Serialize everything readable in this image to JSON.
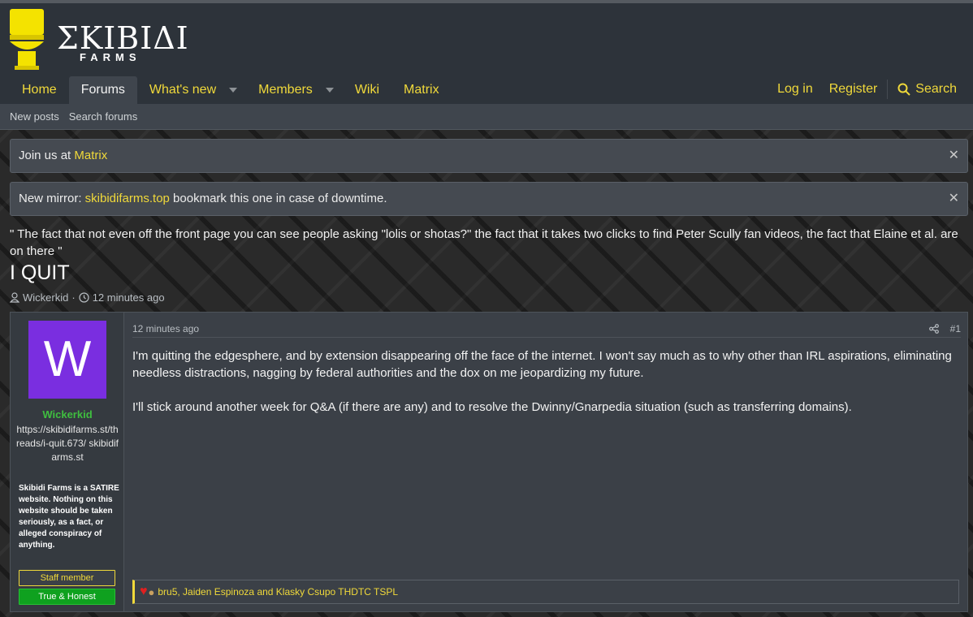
{
  "site": {
    "logo_main": "ΣKIBIΔI",
    "logo_sub": "FARMS"
  },
  "nav": {
    "items": [
      {
        "label": "Home"
      },
      {
        "label": "Forums"
      },
      {
        "label": "What's new"
      },
      {
        "label": "Members"
      },
      {
        "label": "Wiki"
      },
      {
        "label": "Matrix"
      }
    ],
    "login": "Log in",
    "register": "Register",
    "search": "Search"
  },
  "subnav": {
    "new_posts": "New posts",
    "search_forums": "Search forums"
  },
  "notices": [
    {
      "prefix": "Join us at ",
      "link": "Matrix",
      "suffix": ""
    },
    {
      "prefix": "New mirror: ",
      "link": "skibidifarms.top",
      "suffix": " bookmark this one in case of downtime."
    }
  ],
  "thread": {
    "quote_line": "\" The fact that not even off the front page you can see people asking \"lolis or shotas?\" the fact that it takes two clicks to find Peter Scully fan videos, the fact that Elaine et al. are on there \"",
    "title": "I QUIT",
    "author": "Wickerkid",
    "time": "12 minutes ago"
  },
  "post": {
    "avatar_letter": "W",
    "username": "Wickerkid",
    "user_title": "https://skibidifarms.st/threads/i-quit.673/ skibidifarms.st",
    "disclaimer": "Skibidi Farms is a SATIRE website. Nothing on this website should be taken seriously, as a fact, or alleged conspiracy of anything.",
    "badge_staff": "Staff member",
    "badge_honest": "True & Honest",
    "date": "12 minutes ago",
    "number": "#1",
    "paragraphs": [
      "I'm quitting the edgesphere, and by extension disappearing off the face of the internet. I won't say much as to why other than IRL aspirations, eliminating needless distractions, nagging by federal authorities and the dox on me jeopardizing my future.",
      "I'll stick around another week for Q&A (if there are any) and to resolve the Dwinny/Gnarpedia situation (such as transferring domains)."
    ],
    "reactions_text": "bru5, Jaiden Espinoza and Klasky Csupo THDTC TSPL"
  },
  "colors": {
    "accent": "#f0d93a",
    "header_bg": "#2d333a",
    "username": "#3fbf3f",
    "avatar_bg": "#7a2ee0"
  }
}
